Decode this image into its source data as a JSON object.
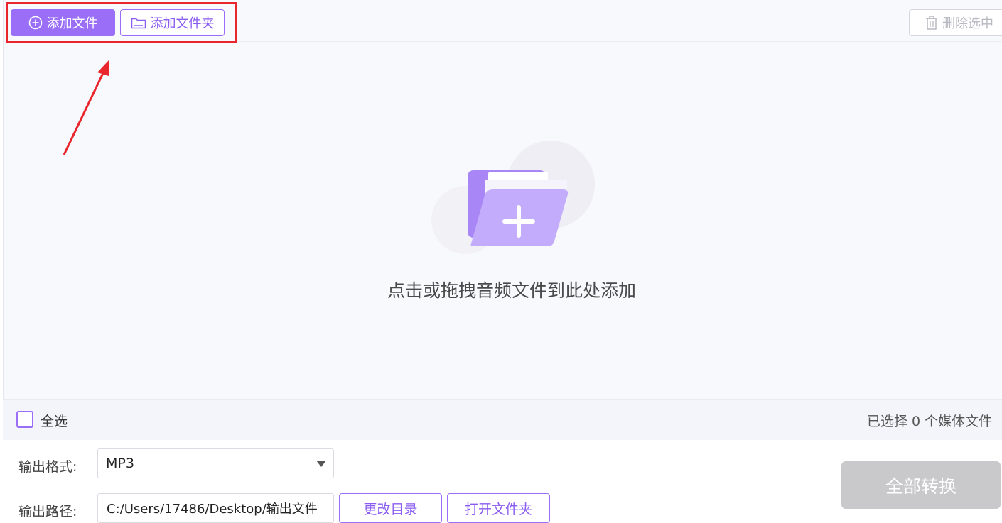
{
  "toolbar": {
    "add_file_label": "添加文件",
    "add_folder_label": "添加文件夹",
    "delete_selected_label": "删除选中"
  },
  "drop_zone": {
    "hint": "点击或拖拽音频文件到此处添加"
  },
  "selection": {
    "select_all_label": "全选",
    "selected_count_text": "已选择 0 个媒体文件"
  },
  "output": {
    "format_label": "输出格式:",
    "format_value": "MP3",
    "path_label": "输出路径:",
    "path_value": "C:/Users/17486/Desktop/输出文件",
    "change_dir_label": "更改目录",
    "open_folder_label": "打开文件夹"
  },
  "convert_all_label": "全部转换",
  "colors": {
    "accent": "#9a6ef7",
    "highlight": "#e8262b",
    "disabled": "#c9c9cc"
  }
}
